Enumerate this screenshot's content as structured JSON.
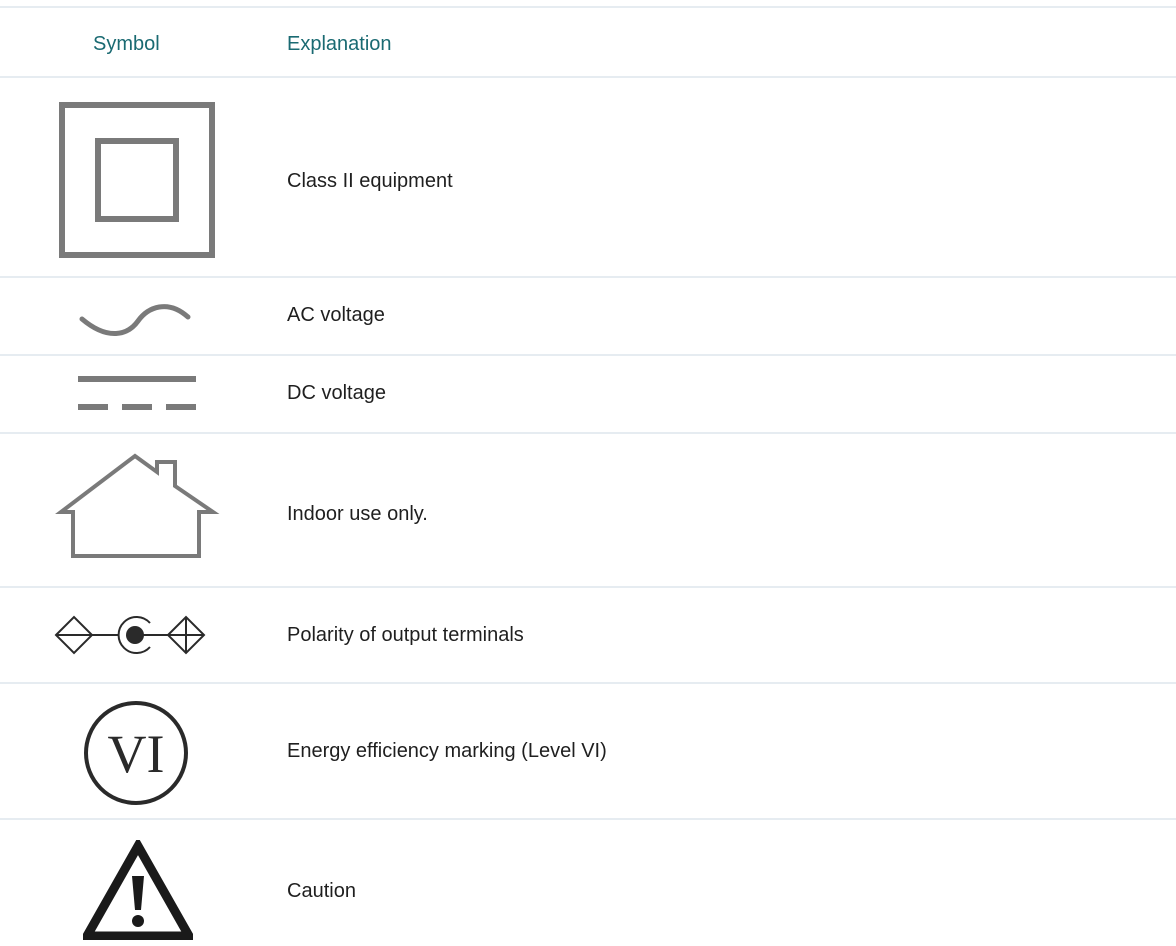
{
  "header": {
    "symbol_label": "Symbol",
    "explanation_label": "Explanation"
  },
  "rows": [
    {
      "icon": "class-ii-equipment-icon",
      "explanation": "Class II equipment"
    },
    {
      "icon": "ac-voltage-icon",
      "explanation": "AC voltage"
    },
    {
      "icon": "dc-voltage-icon",
      "explanation": "DC voltage"
    },
    {
      "icon": "indoor-house-icon",
      "explanation": "Indoor use only."
    },
    {
      "icon": "polarity-icon",
      "explanation": "Polarity of output terminals"
    },
    {
      "icon": "energy-efficiency-vi-icon",
      "explanation": "Energy efficiency marking (Level VI)",
      "symbol_text": "VI"
    },
    {
      "icon": "caution-triangle-icon",
      "explanation": "Caution"
    }
  ],
  "colors": {
    "header_text": "#1a6a72",
    "divider": "#e6ecf1",
    "symbol_gray": "#7a7a7a",
    "symbol_dark": "#2a2a2a"
  }
}
